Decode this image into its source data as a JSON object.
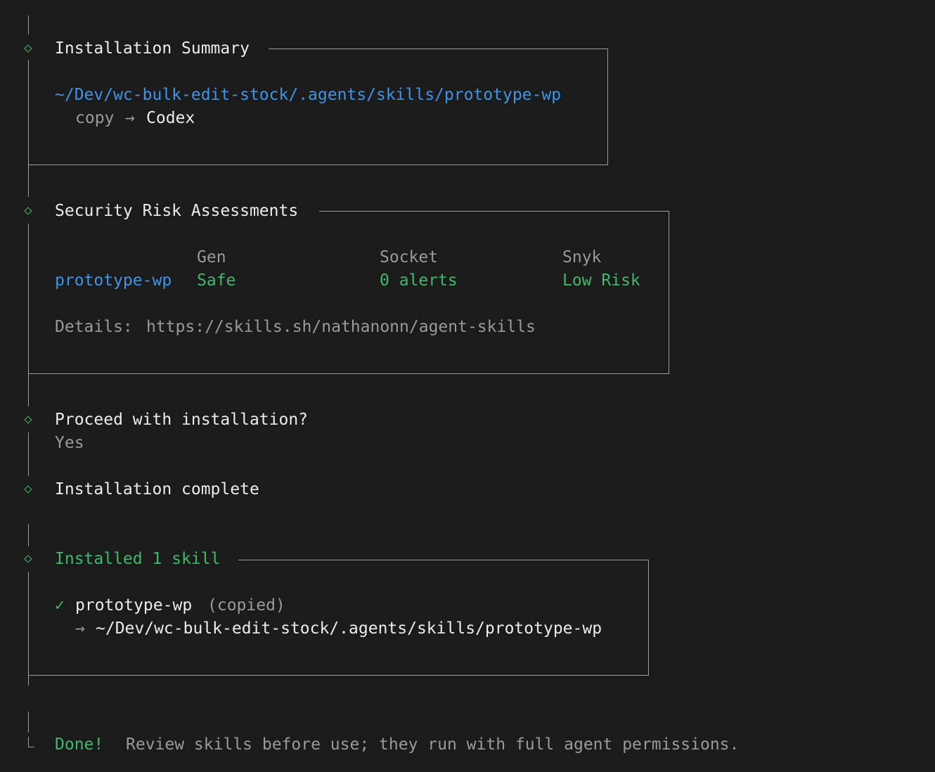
{
  "summary": {
    "title": "Installation Summary",
    "path": "~/Dev/wc-bulk-edit-stock/.agents/skills/prototype-wp",
    "mode": "copy",
    "arrow": "→",
    "target": "Codex"
  },
  "security": {
    "title": "Security Risk Assessments",
    "columns": [
      "Gen",
      "Socket",
      "Snyk"
    ],
    "row": {
      "skill": "prototype-wp",
      "gen": "Safe",
      "socket": "0 alerts",
      "snyk": "Low Risk"
    },
    "details_label": "Details:",
    "details_url": "https://skills.sh/nathanonn/agent-skills"
  },
  "prompt": {
    "question": "Proceed with installation?",
    "answer": "Yes"
  },
  "complete": {
    "text": "Installation complete"
  },
  "installed": {
    "title": "Installed 1 skill",
    "check": "✓",
    "skill": "prototype-wp",
    "status": "(copied)",
    "arrow": "→",
    "path": "~/Dev/wc-bulk-edit-stock/.agents/skills/prototype-wp"
  },
  "footer": {
    "done": "Done!",
    "message": "Review skills before use; they run with full agent permissions."
  },
  "colors": {
    "background": "#1b1b1b",
    "text": "#ececec",
    "muted": "#9a9a9a",
    "blue": "#3d94e8",
    "green": "#3fb96a",
    "rule": "#9c9c9c"
  }
}
